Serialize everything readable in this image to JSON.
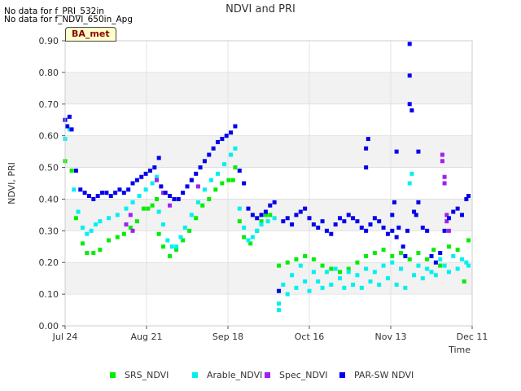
{
  "notes": [
    "No data for f_PRI_532in",
    "No data for f_NDVI_650in_Apg"
  ],
  "badge": "BA_met",
  "colors": {
    "SRS_NDVI": "#00ee00",
    "Arable_NDVI": "#00f0f0",
    "Spec_NDVI": "#a020f0",
    "PAR-SW NDVI": "#0000ee",
    "band": "#f2f2f2",
    "grid": "#dddddd"
  },
  "chart_data": {
    "type": "scatter",
    "title": "NDVI and PRI",
    "xlabel": "Time",
    "ylabel": "NDVI, PRI",
    "xlim": [
      "Jul 24",
      "Dec 11"
    ],
    "x_ticks": [
      "Jul 24",
      "Aug 21",
      "Sep 18",
      "Oct 16",
      "Nov 13",
      "Dec 11"
    ],
    "ylim": [
      0.0,
      0.9
    ],
    "y_ticks": [
      "0.00",
      "0.10",
      "0.20",
      "0.30",
      "0.40",
      "0.50",
      "0.60",
      "0.70",
      "0.80",
      "0.90"
    ],
    "legend_position": "bottom",
    "series": [
      {
        "name": "SRS_NDVI",
        "points": [
          [
            0,
            0.52
          ],
          [
            3,
            0.49
          ],
          [
            5,
            0.34
          ],
          [
            8,
            0.26
          ],
          [
            10,
            0.23
          ],
          [
            13,
            0.23
          ],
          [
            16,
            0.24
          ],
          [
            20,
            0.27
          ],
          [
            24,
            0.28
          ],
          [
            27,
            0.29
          ],
          [
            30,
            0.31
          ],
          [
            33,
            0.33
          ],
          [
            36,
            0.37
          ],
          [
            38,
            0.37
          ],
          [
            40,
            0.38
          ],
          [
            42,
            0.4
          ],
          [
            43,
            0.29
          ],
          [
            45,
            0.25
          ],
          [
            48,
            0.22
          ],
          [
            51,
            0.24
          ],
          [
            54,
            0.27
          ],
          [
            57,
            0.3
          ],
          [
            60,
            0.34
          ],
          [
            63,
            0.38
          ],
          [
            66,
            0.4
          ],
          [
            69,
            0.43
          ],
          [
            72,
            0.45
          ],
          [
            75,
            0.46
          ],
          [
            77,
            0.46
          ],
          [
            78,
            0.5
          ],
          [
            80,
            0.33
          ],
          [
            82,
            0.28
          ],
          [
            85,
            0.26
          ],
          [
            88,
            0.3
          ],
          [
            90,
            0.33
          ],
          [
            92,
            0.35
          ],
          [
            94,
            0.35
          ],
          [
            98,
            0.19
          ],
          [
            102,
            0.2
          ],
          [
            106,
            0.21
          ],
          [
            110,
            0.22
          ],
          [
            114,
            0.21
          ],
          [
            118,
            0.19
          ],
          [
            122,
            0.18
          ],
          [
            126,
            0.17
          ],
          [
            130,
            0.18
          ],
          [
            134,
            0.2
          ],
          [
            138,
            0.22
          ],
          [
            142,
            0.23
          ],
          [
            146,
            0.24
          ],
          [
            150,
            0.22
          ],
          [
            154,
            0.23
          ],
          [
            158,
            0.21
          ],
          [
            162,
            0.23
          ],
          [
            166,
            0.21
          ],
          [
            169,
            0.24
          ],
          [
            172,
            0.19
          ],
          [
            176,
            0.25
          ],
          [
            180,
            0.24
          ],
          [
            183,
            0.14
          ],
          [
            185,
            0.27
          ]
        ]
      },
      {
        "name": "Arable_NDVI",
        "points": [
          [
            0,
            0.59
          ],
          [
            2,
            0.62
          ],
          [
            4,
            0.43
          ],
          [
            6,
            0.36
          ],
          [
            8,
            0.31
          ],
          [
            10,
            0.29
          ],
          [
            12,
            0.3
          ],
          [
            14,
            0.32
          ],
          [
            16,
            0.33
          ],
          [
            20,
            0.34
          ],
          [
            24,
            0.35
          ],
          [
            28,
            0.37
          ],
          [
            31,
            0.39
          ],
          [
            34,
            0.41
          ],
          [
            37,
            0.43
          ],
          [
            40,
            0.45
          ],
          [
            42,
            0.47
          ],
          [
            43,
            0.36
          ],
          [
            45,
            0.32
          ],
          [
            47,
            0.27
          ],
          [
            49,
            0.25
          ],
          [
            51,
            0.25
          ],
          [
            53,
            0.28
          ],
          [
            55,
            0.31
          ],
          [
            58,
            0.35
          ],
          [
            61,
            0.39
          ],
          [
            64,
            0.43
          ],
          [
            67,
            0.46
          ],
          [
            70,
            0.48
          ],
          [
            73,
            0.51
          ],
          [
            76,
            0.54
          ],
          [
            78,
            0.56
          ],
          [
            80,
            0.37
          ],
          [
            82,
            0.31
          ],
          [
            84,
            0.27
          ],
          [
            86,
            0.28
          ],
          [
            88,
            0.3
          ],
          [
            90,
            0.32
          ],
          [
            93,
            0.33
          ],
          [
            96,
            0.34
          ],
          [
            98,
            0.07
          ],
          [
            98,
            0.05
          ],
          [
            100,
            0.13
          ],
          [
            102,
            0.1
          ],
          [
            104,
            0.16
          ],
          [
            106,
            0.12
          ],
          [
            108,
            0.19
          ],
          [
            110,
            0.14
          ],
          [
            112,
            0.11
          ],
          [
            114,
            0.17
          ],
          [
            116,
            0.14
          ],
          [
            118,
            0.12
          ],
          [
            120,
            0.17
          ],
          [
            122,
            0.13
          ],
          [
            124,
            0.18
          ],
          [
            126,
            0.15
          ],
          [
            128,
            0.12
          ],
          [
            130,
            0.17
          ],
          [
            132,
            0.13
          ],
          [
            134,
            0.16
          ],
          [
            136,
            0.12
          ],
          [
            138,
            0.18
          ],
          [
            140,
            0.14
          ],
          [
            142,
            0.17
          ],
          [
            144,
            0.13
          ],
          [
            146,
            0.19
          ],
          [
            148,
            0.15
          ],
          [
            150,
            0.2
          ],
          [
            152,
            0.13
          ],
          [
            154,
            0.18
          ],
          [
            156,
            0.12
          ],
          [
            158,
            0.45
          ],
          [
            159,
            0.48
          ],
          [
            160,
            0.16
          ],
          [
            162,
            0.19
          ],
          [
            164,
            0.15
          ],
          [
            166,
            0.18
          ],
          [
            168,
            0.17
          ],
          [
            170,
            0.16
          ],
          [
            172,
            0.21
          ],
          [
            174,
            0.19
          ],
          [
            176,
            0.17
          ],
          [
            178,
            0.22
          ],
          [
            180,
            0.18
          ],
          [
            182,
            0.21
          ],
          [
            184,
            0.2
          ],
          [
            185,
            0.19
          ]
        ]
      },
      {
        "name": "Spec_NDVI",
        "points": [
          [
            28,
            0.32
          ],
          [
            30,
            0.35
          ],
          [
            31,
            0.3
          ],
          [
            42,
            0.46
          ],
          [
            45,
            0.42
          ],
          [
            48,
            0.38
          ],
          [
            58,
            0.46
          ],
          [
            61,
            0.44
          ],
          [
            173,
            0.54
          ],
          [
            173,
            0.52
          ],
          [
            174,
            0.47
          ],
          [
            174,
            0.45
          ],
          [
            175,
            0.35
          ],
          [
            175,
            0.33
          ],
          [
            176,
            0.3
          ]
        ]
      },
      {
        "name": "PAR-SW NDVI",
        "points": [
          [
            0,
            0.65
          ],
          [
            1,
            0.63
          ],
          [
            2,
            0.66
          ],
          [
            3,
            0.62
          ],
          [
            5,
            0.49
          ],
          [
            7,
            0.43
          ],
          [
            9,
            0.42
          ],
          [
            11,
            0.41
          ],
          [
            13,
            0.4
          ],
          [
            15,
            0.41
          ],
          [
            17,
            0.42
          ],
          [
            19,
            0.42
          ],
          [
            21,
            0.41
          ],
          [
            23,
            0.42
          ],
          [
            25,
            0.43
          ],
          [
            27,
            0.42
          ],
          [
            29,
            0.43
          ],
          [
            31,
            0.45
          ],
          [
            33,
            0.46
          ],
          [
            35,
            0.47
          ],
          [
            37,
            0.48
          ],
          [
            39,
            0.49
          ],
          [
            41,
            0.5
          ],
          [
            43,
            0.53
          ],
          [
            44,
            0.44
          ],
          [
            46,
            0.42
          ],
          [
            48,
            0.41
          ],
          [
            50,
            0.4
          ],
          [
            52,
            0.4
          ],
          [
            54,
            0.42
          ],
          [
            56,
            0.44
          ],
          [
            58,
            0.46
          ],
          [
            60,
            0.48
          ],
          [
            62,
            0.5
          ],
          [
            64,
            0.52
          ],
          [
            66,
            0.54
          ],
          [
            68,
            0.56
          ],
          [
            70,
            0.58
          ],
          [
            72,
            0.59
          ],
          [
            74,
            0.6
          ],
          [
            76,
            0.61
          ],
          [
            78,
            0.63
          ],
          [
            80,
            0.49
          ],
          [
            82,
            0.45
          ],
          [
            84,
            0.37
          ],
          [
            86,
            0.35
          ],
          [
            88,
            0.34
          ],
          [
            90,
            0.35
          ],
          [
            92,
            0.36
          ],
          [
            94,
            0.38
          ],
          [
            96,
            0.39
          ],
          [
            98,
            0.11
          ],
          [
            100,
            0.33
          ],
          [
            102,
            0.34
          ],
          [
            104,
            0.32
          ],
          [
            106,
            0.35
          ],
          [
            108,
            0.36
          ],
          [
            110,
            0.37
          ],
          [
            112,
            0.34
          ],
          [
            114,
            0.32
          ],
          [
            116,
            0.31
          ],
          [
            118,
            0.33
          ],
          [
            120,
            0.3
          ],
          [
            122,
            0.29
          ],
          [
            124,
            0.32
          ],
          [
            126,
            0.34
          ],
          [
            128,
            0.33
          ],
          [
            130,
            0.35
          ],
          [
            132,
            0.34
          ],
          [
            134,
            0.33
          ],
          [
            136,
            0.31
          ],
          [
            138,
            0.3
          ],
          [
            140,
            0.32
          ],
          [
            142,
            0.34
          ],
          [
            144,
            0.33
          ],
          [
            146,
            0.31
          ],
          [
            148,
            0.29
          ],
          [
            150,
            0.3
          ],
          [
            152,
            0.28
          ],
          [
            152,
            0.55
          ],
          [
            150,
            0.35
          ],
          [
            151,
            0.39
          ],
          [
            153,
            0.31
          ],
          [
            155,
            0.25
          ],
          [
            156,
            0.22
          ],
          [
            157,
            0.3
          ],
          [
            158,
            0.7
          ],
          [
            158,
            0.79
          ],
          [
            158,
            0.89
          ],
          [
            159,
            0.68
          ],
          [
            160,
            0.36
          ],
          [
            161,
            0.35
          ],
          [
            162,
            0.39
          ],
          [
            162,
            0.55
          ],
          [
            164,
            0.31
          ],
          [
            166,
            0.3
          ],
          [
            168,
            0.22
          ],
          [
            170,
            0.2
          ],
          [
            172,
            0.23
          ],
          [
            174,
            0.3
          ],
          [
            176,
            0.34
          ],
          [
            178,
            0.36
          ],
          [
            180,
            0.37
          ],
          [
            182,
            0.35
          ],
          [
            184,
            0.4
          ],
          [
            185,
            0.41
          ],
          [
            138,
            0.5
          ],
          [
            138,
            0.56
          ],
          [
            139,
            0.59
          ]
        ]
      }
    ]
  }
}
